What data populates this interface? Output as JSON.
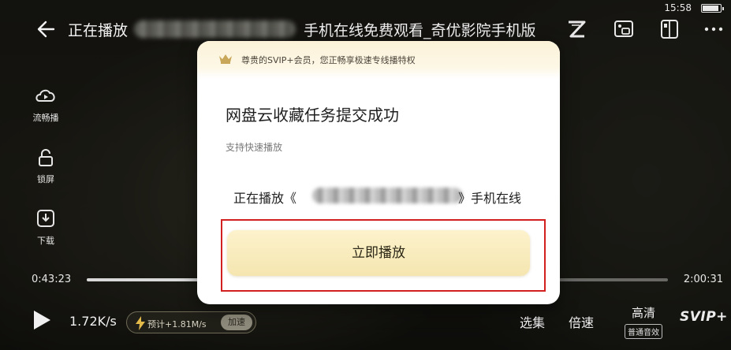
{
  "status_bar": {
    "time": "15:58"
  },
  "header": {
    "title_prefix": "正在播放",
    "title_suffix": "手机在线免费观看_奇优影院手机版"
  },
  "side_controls": {
    "smooth": "流畅播",
    "lock": "锁屏",
    "download": "下载"
  },
  "progress": {
    "current": "0:43:23",
    "total": "2:00:31",
    "fraction": 0.36
  },
  "bottom": {
    "speed": "1.72K/s",
    "boost_estimate": "预计+1.81M/s",
    "boost_button": "加速",
    "episodes": "选集",
    "playback_speed": "倍速",
    "quality": "高清",
    "audio": "普通音效",
    "svip": "SVIP+"
  },
  "modal": {
    "banner": "尊贵的SVIP+会员，您正畅享极速专线播特权",
    "title": "网盘云收藏任务提交成功",
    "subtitle": "支持快速播放",
    "playing_prefix": "正在播放《",
    "playing_suffix": "》手机在线",
    "play_button": "立即播放"
  },
  "colors": {
    "highlight": "#d21f1f",
    "button_gold": "#f5e6b0"
  }
}
